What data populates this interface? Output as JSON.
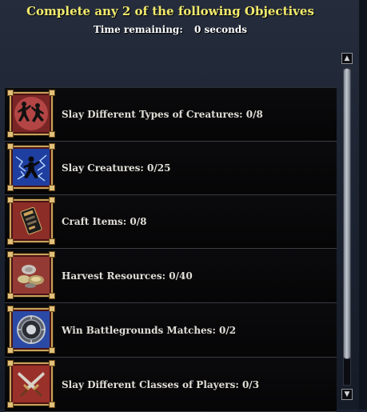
{
  "header": {
    "title": "Complete any 2 of the following Objectives",
    "time_label": "Time remaining:",
    "time_value": "0 seconds"
  },
  "objectives": [
    {
      "label": "Slay Different Types of Creatures: 0/8",
      "icon": "dancing-figures-icon"
    },
    {
      "label": "Slay Creatures: 0/25",
      "icon": "lightning-creature-icon"
    },
    {
      "label": "Craft Items: 0/8",
      "icon": "crafting-icon"
    },
    {
      "label": "Harvest Resources: 0/40",
      "icon": "harvest-icon"
    },
    {
      "label": "Win Battlegrounds Matches: 0/2",
      "icon": "battleground-medal-icon"
    },
    {
      "label": "Slay Different Classes of Players: 0/3",
      "icon": "crossed-daggers-icon"
    }
  ],
  "scrollbar": {
    "up_arrow": "▲",
    "down_arrow": "▼",
    "thumb_fraction": 0.92
  },
  "colors": {
    "title": "#f2ea6c",
    "frame_gold": "#c7a25a",
    "icon_bg": "#7a2626"
  }
}
